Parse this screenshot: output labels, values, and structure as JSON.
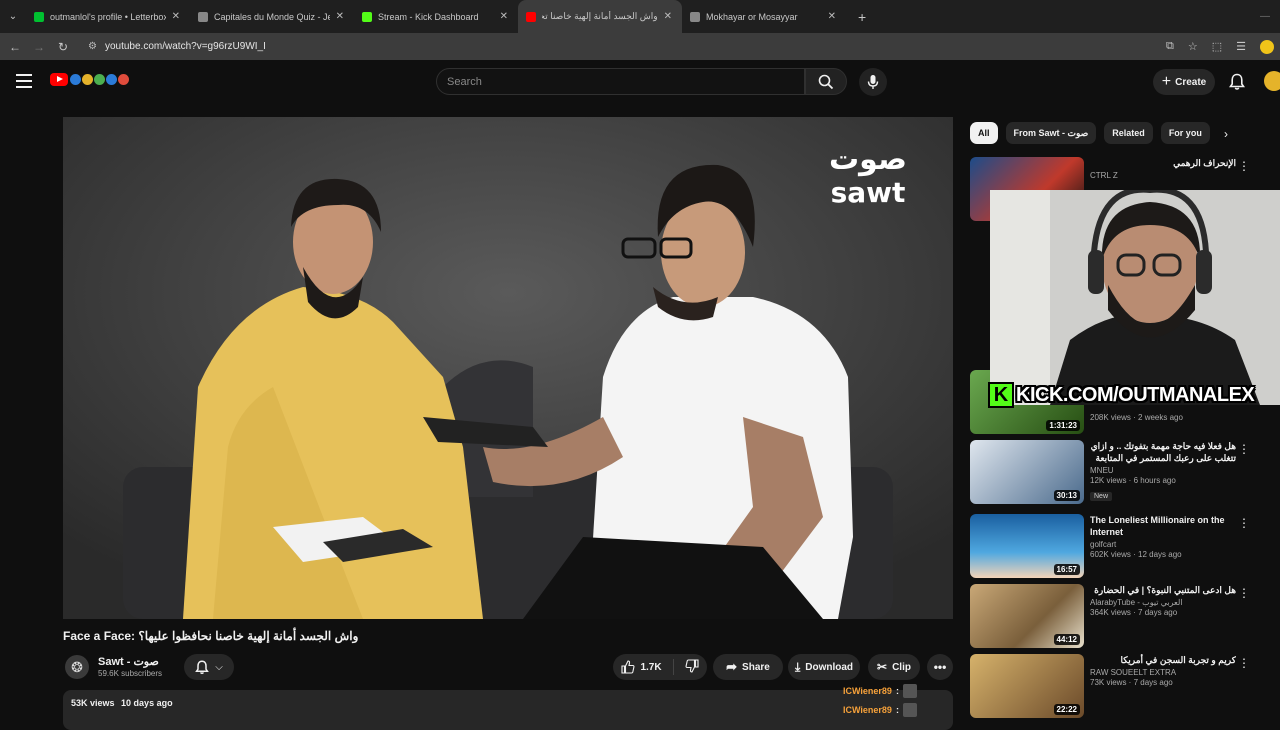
{
  "browser": {
    "tabs": [
      {
        "title": "outmanlol's profile • Letterboxd",
        "favicon_color": "#00c030"
      },
      {
        "title": "Capitales du Monde Quiz - Jeu",
        "favicon_color": "#888888"
      },
      {
        "title": "Stream - Kick Dashboard",
        "favicon_color": "#53fc18"
      },
      {
        "title": "واش الجسد أمانة إلهية خاصنا تحا",
        "favicon_color": "#ff0000"
      },
      {
        "title": "Mokhayar or Mosayyar",
        "favicon_color": "#888888"
      }
    ],
    "url": "youtube.com/watch?v=g96rzU9WI_I"
  },
  "header": {
    "search_placeholder": "Search",
    "create_label": "Create"
  },
  "video": {
    "title": "Face a Face: واش الجسد أمانة إلهية خاصنا نحافظوا عليها؟",
    "channel": "Sawt - صوت",
    "subscribers": "59.6K subscribers",
    "likes": "1.7K",
    "share_label": "Share",
    "download_label": "Download",
    "clip_label": "Clip",
    "views": "53K views",
    "date": "10 days ago",
    "watermark": "صوت sawt"
  },
  "chat_overlay": [
    {
      "user": "ICWiener89",
      "colon": ":"
    },
    {
      "user": "ICWiener89",
      "colon": ":"
    }
  ],
  "chips": [
    "All",
    "From Sawt - صوت",
    "Related",
    "For you"
  ],
  "recommendations": [
    {
      "title": "الإنحراف الرهمي",
      "channel": "CTRL Z",
      "views": "",
      "duration": "",
      "rtl": true,
      "new": false
    },
    {
      "title": "",
      "channel": "",
      "views": "208K views · 2 weeks ago",
      "duration": "1:31:23",
      "rtl": false,
      "new": false
    },
    {
      "title": "هل فعلا فيه حاجة مهمة بتفوتك .. و ازاي تتغلب على رعبك المستمر في المتابعة ...",
      "channel": "MNEU",
      "views": "12K views · 6 hours ago",
      "duration": "30:13",
      "rtl": true,
      "new": true,
      "new_label": "New"
    },
    {
      "title": "The Loneliest Millionaire on the Internet",
      "channel": "golfcart",
      "views": "602K views · 12 days ago",
      "duration": "16:57",
      "rtl": false,
      "new": false
    },
    {
      "title": "هل ادعى المتنبي النبوة؟ | في الحضارة",
      "channel": "AlarabyTube - العربي تيوب",
      "views": "364K views · 7 days ago",
      "duration": "44:12",
      "rtl": true,
      "new": false
    },
    {
      "title": "كريم و تجربة السجن في أمريكا",
      "channel": "RAW SOUEELT EXTRA",
      "views": "73K views · 7 days ago",
      "duration": "22:22",
      "rtl": true,
      "new": false
    }
  ],
  "kick_banner": {
    "k": "K",
    "url": "KICK.COM/OUTMANALEX"
  }
}
